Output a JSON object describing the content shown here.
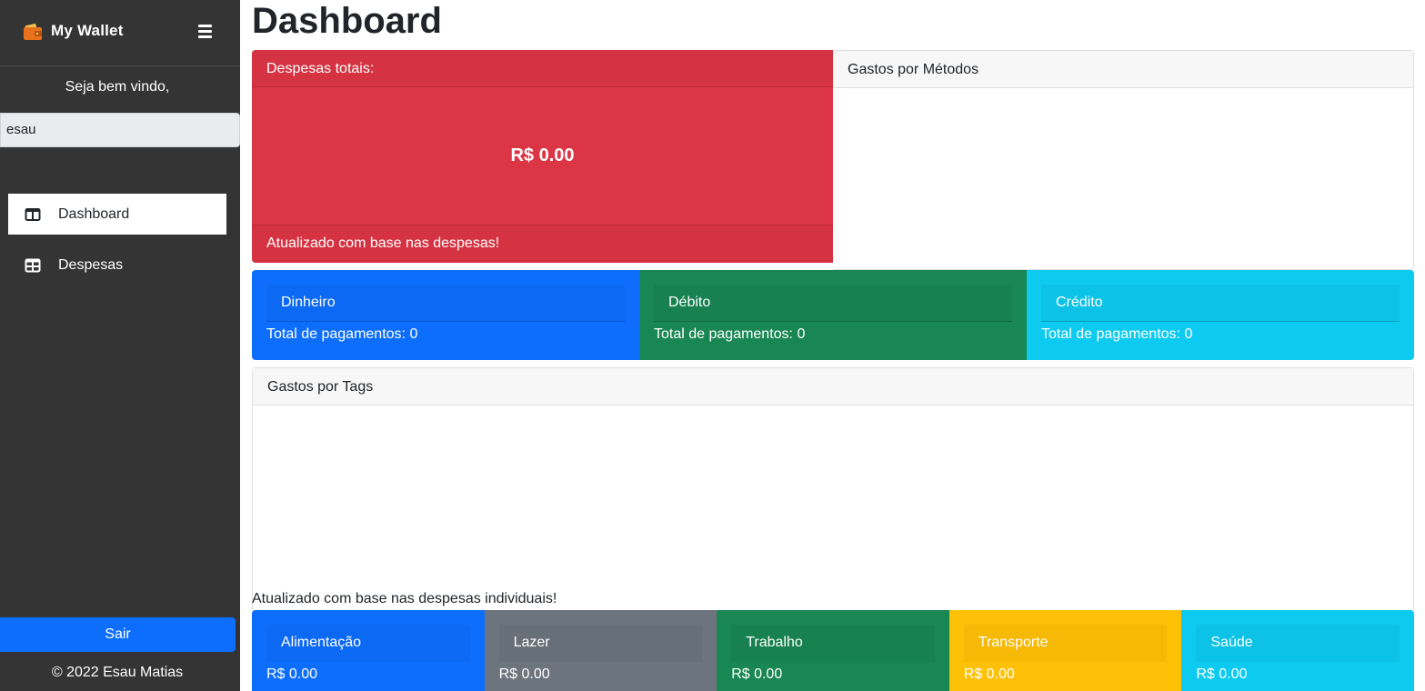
{
  "sidebar": {
    "brand": "My Wallet",
    "brand_icon": "wallet-icon",
    "welcome": "Seja bem vindo,",
    "username": "esau",
    "nav": [
      {
        "label": "Dashboard",
        "icon": "columns-icon",
        "active": true
      },
      {
        "label": "Despesas",
        "icon": "grid-icon",
        "active": false
      }
    ],
    "logout_label": "Sair",
    "copyright": "© 2022 Esau Matias"
  },
  "main": {
    "title": "Dashboard",
    "total_card": {
      "header": "Despesas totais:",
      "value": "R$ 0.00",
      "footer": "Atualizado com base nas despesas!",
      "color": "#dc3545"
    },
    "methods_card": {
      "header": "Gastos por Métodos"
    },
    "methods": [
      {
        "label": "Dinheiro",
        "total": "Total de pagamentos: 0",
        "color": "#0d6efd"
      },
      {
        "label": "Débito",
        "total": "Total de pagamentos: 0",
        "color": "#198754"
      },
      {
        "label": "Crédito",
        "total": "Total de pagamentos: 0",
        "color": "#0dcaf0"
      }
    ],
    "tags_card": {
      "header": "Gastos por Tags",
      "note": "Atualizado com base nas despesas individuais!"
    },
    "tags": [
      {
        "label": "Alimentação",
        "total": "R$ 0.00",
        "color": "#0d6efd"
      },
      {
        "label": "Lazer",
        "total": "R$ 0.00",
        "color": "#6c757d"
      },
      {
        "label": "Trabalho",
        "total": "R$ 0.00",
        "color": "#198754"
      },
      {
        "label": "Transporte",
        "total": "R$ 0.00",
        "color": "#ffc107"
      },
      {
        "label": "Saúde",
        "total": "R$ 0.00",
        "color": "#0dcaf0"
      }
    ]
  }
}
